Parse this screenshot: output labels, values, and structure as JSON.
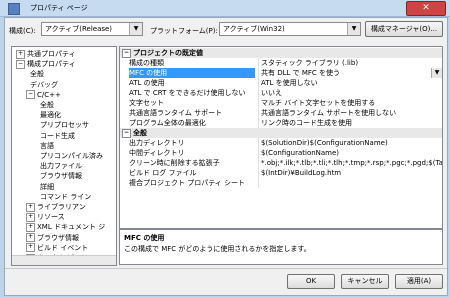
{
  "window": {
    "title": "プロパティ ページ"
  },
  "header": {
    "config_label": "構成(C):",
    "config_value": "アクティブ(Release)",
    "platform_label": "プラットフォーム(P):",
    "platform_value": "アクティブ(Win32)",
    "config_manager_label": "構成マネージャ(O)..."
  },
  "tree": {
    "items": [
      {
        "label": "共通プロパティ",
        "exp": "+"
      },
      {
        "label": "構成プロパティ",
        "exp": "−"
      },
      {
        "label": "全般"
      },
      {
        "label": "デバッグ"
      },
      {
        "label": "C/C++",
        "exp": "−"
      },
      {
        "label": "全般"
      },
      {
        "label": "最適化"
      },
      {
        "label": "プリプロセッサ"
      },
      {
        "label": "コード生成"
      },
      {
        "label": "言語"
      },
      {
        "label": "プリコンパイル済み"
      },
      {
        "label": "出力ファイル"
      },
      {
        "label": "ブラウザ情報"
      },
      {
        "label": "詳細"
      },
      {
        "label": "コマンド ライン"
      },
      {
        "label": "ライブラリアン",
        "exp": "+"
      },
      {
        "label": "リソース",
        "exp": "+"
      },
      {
        "label": "XML ドキュメント ジ",
        "exp": "+"
      },
      {
        "label": "ブラウザ情報",
        "exp": "+"
      },
      {
        "label": "ビルド イベント",
        "exp": "+"
      },
      {
        "label": "カスタム ビルド ステ",
        "exp": "+"
      }
    ]
  },
  "grid": {
    "cat1": "プロジェクトの既定値",
    "cat2": "全般",
    "rows1": [
      {
        "name": "構成の種類",
        "value": "スタティック ライブラリ (.lib)"
      },
      {
        "name": "MFC の使用",
        "value": "共有 DLL で MFC を使う"
      },
      {
        "name": "ATL の使用",
        "value": "ATL を使用しない"
      },
      {
        "name": "ATL で CRT をできるだけ使用しない",
        "value": "いいえ"
      },
      {
        "name": "文字セット",
        "value": "マルチ バイト文字セットを使用する"
      },
      {
        "name": "共通言語ランタイム サポート",
        "value": "共通言語ランタイム サポートを使用しない"
      },
      {
        "name": "プログラム全体の最適化",
        "value": "リンク時のコード生成を使用"
      }
    ],
    "rows2": [
      {
        "name": "出力ディレクトリ",
        "value": "$(SolutionDir)$(ConfigurationName)"
      },
      {
        "name": "中間ディレクトリ",
        "value": "$(ConfigurationName)"
      },
      {
        "name": "クリーン時に削除する拡張子",
        "value": "*.obj;*.ilk;*.tlb;*.tli;*.tlh;*.tmp;*.rsp;*.pgc;*.pgd;$(Targe"
      },
      {
        "name": "ビルド ログ ファイル",
        "value": "$(IntDir)¥BuildLog.htm"
      },
      {
        "name": "複合プロジェクト プロパティ シート",
        "value": ""
      }
    ]
  },
  "description": {
    "title": "MFC の使用",
    "text": "この構成で MFC がどのように使用されるかを指定します。"
  },
  "buttons": {
    "ok": "OK",
    "cancel": "キャンセル",
    "apply": "適用(A)"
  }
}
